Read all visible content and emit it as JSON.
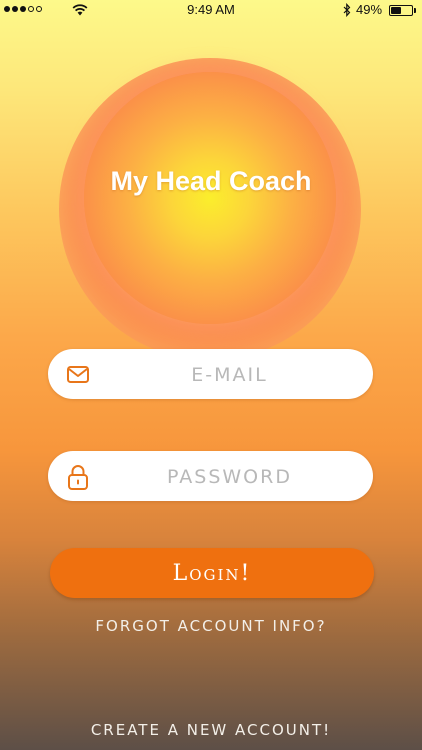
{
  "status_bar": {
    "time": "9:49 AM",
    "battery_percent": "49%",
    "battery_level": 0.49,
    "signal_bars_filled": 3,
    "signal_bars_total": 5
  },
  "app": {
    "title": "My Head Coach"
  },
  "login_form": {
    "email_placeholder": "E-MAIL",
    "email_value": "",
    "password_placeholder": "PASSWORD",
    "password_value": "",
    "login_label": "Login!",
    "forgot_label": "FORGOT ACCOUNT INFO?",
    "create_account_label": "CREATE A NEW ACCOUNT!"
  },
  "icons": {
    "email": "envelope-icon",
    "password": "lock-icon"
  },
  "colors": {
    "accent": "#ef700f",
    "icon": "#e8761a"
  }
}
